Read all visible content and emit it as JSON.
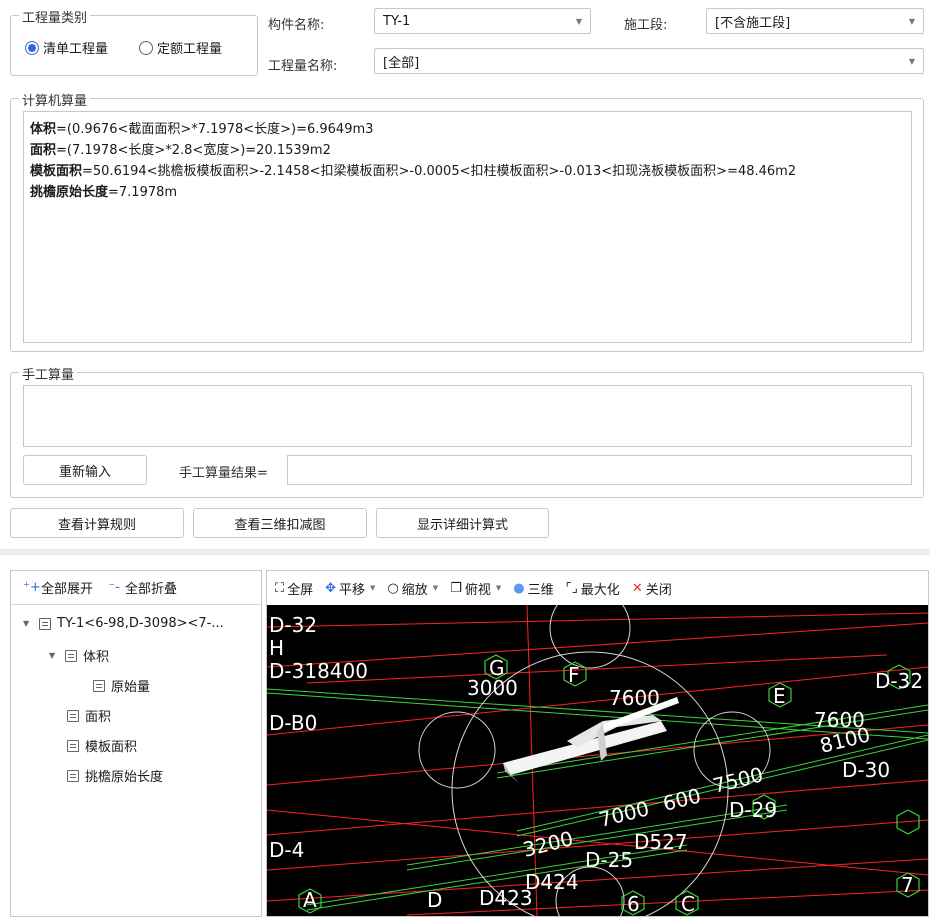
{
  "qty_type": {
    "legend": "工程量类别",
    "options": [
      {
        "label": "清单工程量",
        "selected": true
      },
      {
        "label": "定额工程量",
        "selected": false
      }
    ]
  },
  "component": {
    "label": "构件名称:",
    "value": "TY-1"
  },
  "stage": {
    "label": "施工段:",
    "value": "[不含施工段]"
  },
  "qty_name": {
    "label": "工程量名称:",
    "value": "[全部]"
  },
  "computer_calc": {
    "legend": "计算机算量",
    "lines": [
      {
        "name": "体积",
        "expr": "=(0.9676<截面面积>*7.1978<长度>)=6.9649m3"
      },
      {
        "name": "面积",
        "expr": "=(7.1978<长度>*2.8<宽度>)=20.1539m2"
      },
      {
        "name": "模板面积",
        "expr": "=50.6194<挑檐板模板面积>-2.1458<扣梁模板面积>-0.0005<扣柱模板面积>-0.013<扣现浇板模板面积>=48.46m2"
      },
      {
        "name": "挑檐原始长度",
        "expr": "=7.1978m"
      }
    ]
  },
  "manual_calc": {
    "legend": "手工算量",
    "reinput_button": "重新输入",
    "result_label": "手工算量结果=",
    "result_value": ""
  },
  "actions": {
    "view_rules": "查看计算规则",
    "view_3d": "查看三维扣减图",
    "show_detail": "显示详细计算式"
  },
  "tree_toolbar": {
    "expand_all": "全部展开",
    "collapse_all": "全部折叠"
  },
  "tree": {
    "root": "TY-1<6-98,D-3098><7-...",
    "volume": "体积",
    "original": "原始量",
    "area": "面积",
    "formwork": "模板面积",
    "eave_length": "挑檐原始长度"
  },
  "view_toolbar": {
    "fullscreen": "全屏",
    "pan": "平移",
    "zoom": "缩放",
    "top_view": "俯视",
    "three_d": "三维",
    "maximize": "最大化",
    "close": "关闭"
  },
  "colors": {
    "accent": "#2a6fdb",
    "close_red": "#e03030",
    "canvas_bg": "#000000",
    "grid_red": "#ff2020",
    "grid_green": "#3bd33b"
  },
  "scene_labels": {
    "d32_tl": "D-32",
    "h": "H",
    "d318400": "D-318400",
    "g": "G",
    "n3000": "3000",
    "f": "F",
    "n7600a": "7600",
    "e_top": "E",
    "d32_tr": "D-32",
    "db0": "D-B0",
    "n7600b": "7600",
    "n8100": "8100",
    "d30": "D-30",
    "n7500": "7500",
    "d29": "D-29",
    "n7000": "7000",
    "n600": "600",
    "d527": "D527",
    "d25": "D-25",
    "n3200": "3200",
    "d424": "D424",
    "d423": "D423",
    "d4": "D-4",
    "n6": "6",
    "c": "C",
    "n7": "7",
    "a": "A",
    "d": "D"
  }
}
